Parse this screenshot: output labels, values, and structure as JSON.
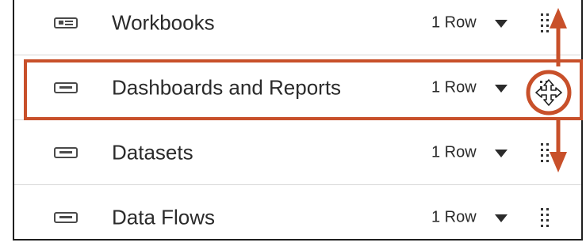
{
  "rows": [
    {
      "label": "Workbooks",
      "count": "1 Row",
      "icon": "workbook-icon"
    },
    {
      "label": "Dashboards and Reports",
      "count": "1 Row",
      "icon": "dashboard-icon"
    },
    {
      "label": "Datasets",
      "count": "1 Row",
      "icon": "dataset-icon"
    },
    {
      "label": "Data Flows",
      "count": "1 Row",
      "icon": "dataflow-icon"
    }
  ],
  "annotation": {
    "accent": "#c8502a",
    "cursor": "move-cursor-icon"
  }
}
